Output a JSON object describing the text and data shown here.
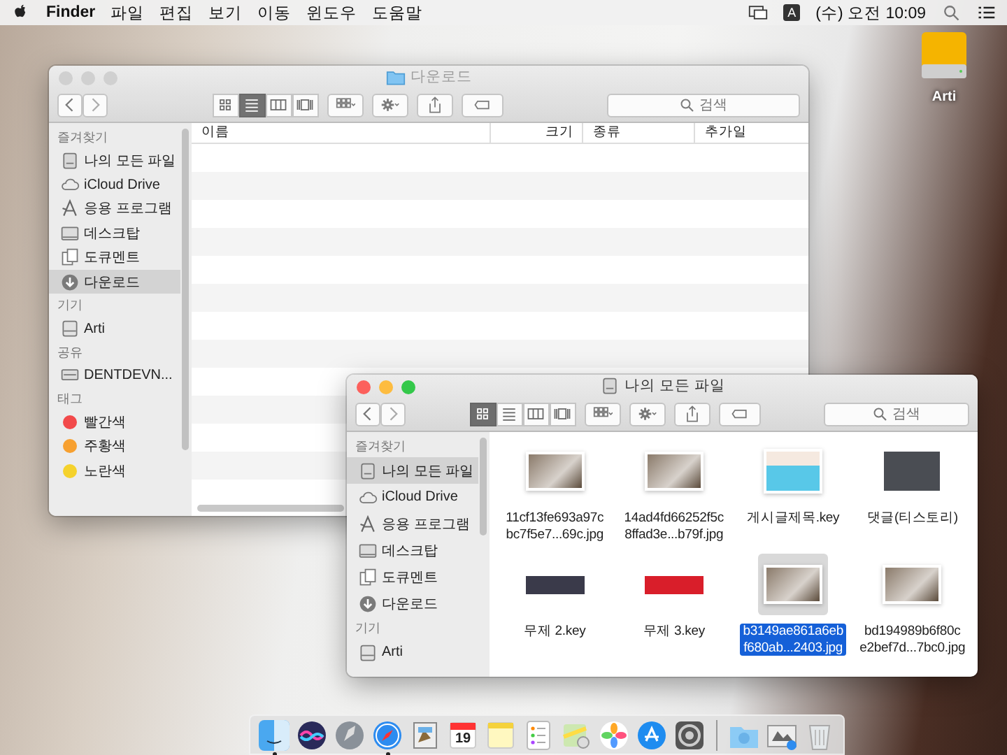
{
  "menubar": {
    "app": "Finder",
    "menus": [
      "파일",
      "편집",
      "보기",
      "이동",
      "윈도우",
      "도움말"
    ],
    "input_source": "A",
    "clock": "(수) 오전 10:09"
  },
  "desktop_icons": [
    {
      "label": "Arti"
    }
  ],
  "windows": [
    {
      "title": "다운로드",
      "active": false,
      "search_placeholder": "검색",
      "view_buttons": [
        {
          "kind": "icon",
          "selected": false
        },
        {
          "kind": "list",
          "selected": true
        },
        {
          "kind": "column",
          "selected": false
        },
        {
          "kind": "cover",
          "selected": false
        }
      ],
      "sidebar": [
        {
          "heading": "즐겨찾기",
          "items": [
            {
              "kind": "allfiles",
              "label": "나의 모든 파일",
              "selected": false
            },
            {
              "kind": "cloud",
              "label": "iCloud Drive",
              "selected": false
            },
            {
              "kind": "apps",
              "label": "응용 프로그램",
              "selected": false
            },
            {
              "kind": "desktop",
              "label": "데스크탑",
              "selected": false
            },
            {
              "kind": "documents",
              "label": "도큐멘트",
              "selected": false
            },
            {
              "kind": "downloads",
              "label": "다운로드",
              "selected": true
            }
          ]
        },
        {
          "heading": "기기",
          "items": [
            {
              "kind": "disk",
              "label": "Arti",
              "selected": false
            }
          ]
        },
        {
          "heading": "공유",
          "items": [
            {
              "kind": "server",
              "label": "DENTDEVN...",
              "selected": false
            }
          ]
        },
        {
          "heading": "태그",
          "items": [
            {
              "kind": "tag",
              "label": "빨간색",
              "color": "#f2494a",
              "selected": false
            },
            {
              "kind": "tag",
              "label": "주황색",
              "color": "#f7a030",
              "selected": false
            },
            {
              "kind": "tag",
              "label": "노란색",
              "color": "#f5d22c",
              "selected": false
            }
          ]
        }
      ],
      "columns": [
        "이름",
        "크기",
        "종류",
        "추가일"
      ]
    },
    {
      "title": "나의 모든 파일",
      "active": true,
      "search_placeholder": "검색",
      "view_buttons": [
        {
          "kind": "icon",
          "selected": true
        },
        {
          "kind": "list",
          "selected": false
        },
        {
          "kind": "column",
          "selected": false
        },
        {
          "kind": "cover",
          "selected": false
        }
      ],
      "sidebar": [
        {
          "heading": "즐겨찾기",
          "items": [
            {
              "kind": "allfiles",
              "label": "나의 모든 파일",
              "selected": true
            },
            {
              "kind": "cloud",
              "label": "iCloud Drive",
              "selected": false
            },
            {
              "kind": "apps",
              "label": "응용 프로그램",
              "selected": false
            },
            {
              "kind": "desktop",
              "label": "데스크탑",
              "selected": false
            },
            {
              "kind": "documents",
              "label": "도큐멘트",
              "selected": false
            },
            {
              "kind": "downloads",
              "label": "다운로드",
              "selected": false
            }
          ]
        },
        {
          "heading": "기기",
          "items": [
            {
              "kind": "disk",
              "label": "Arti",
              "selected": false
            }
          ]
        }
      ],
      "files": [
        {
          "kind": "image",
          "lines": [
            "11cf13fe693a97c",
            "bc7f5e7...69c.jpg"
          ],
          "selected": false
        },
        {
          "kind": "image",
          "lines": [
            "14ad4fd66252f5c",
            "8ffad3e...b79f.jpg"
          ],
          "selected": false
        },
        {
          "kind": "slide",
          "lines": [
            "게시글제목.key"
          ],
          "selected": false
        },
        {
          "kind": "dark",
          "lines": [
            "댓글(티스토리)"
          ],
          "selected": false
        },
        {
          "kind": "banner",
          "lines": [
            "무제 2.key"
          ],
          "selected": false
        },
        {
          "kind": "banner",
          "lines": [
            "무제 3.key"
          ],
          "selected": false
        },
        {
          "kind": "image",
          "lines": [
            "b3149ae861a6eb",
            "f680ab...2403.jpg"
          ],
          "selected": true
        },
        {
          "kind": "image",
          "lines": [
            "bd194989b6f80c",
            "e2bef7d...7bc0.jpg"
          ],
          "selected": false
        }
      ]
    }
  ],
  "dock": [
    {
      "kind": "finder",
      "running": true
    },
    {
      "kind": "siri",
      "running": false
    },
    {
      "kind": "launchpad",
      "running": false
    },
    {
      "kind": "safari",
      "running": true
    },
    {
      "kind": "preview",
      "running": false
    },
    {
      "kind": "calendar",
      "label": "19",
      "running": false
    },
    {
      "kind": "notes",
      "running": false
    },
    {
      "kind": "reminders",
      "running": false
    },
    {
      "kind": "maps",
      "running": false
    },
    {
      "kind": "photos",
      "running": false
    },
    {
      "kind": "appstore",
      "running": false
    },
    {
      "kind": "settings",
      "running": false
    },
    {
      "kind": "separator"
    },
    {
      "kind": "downloads",
      "running": false
    },
    {
      "kind": "stack",
      "running": false
    },
    {
      "kind": "trash",
      "running": false
    }
  ]
}
